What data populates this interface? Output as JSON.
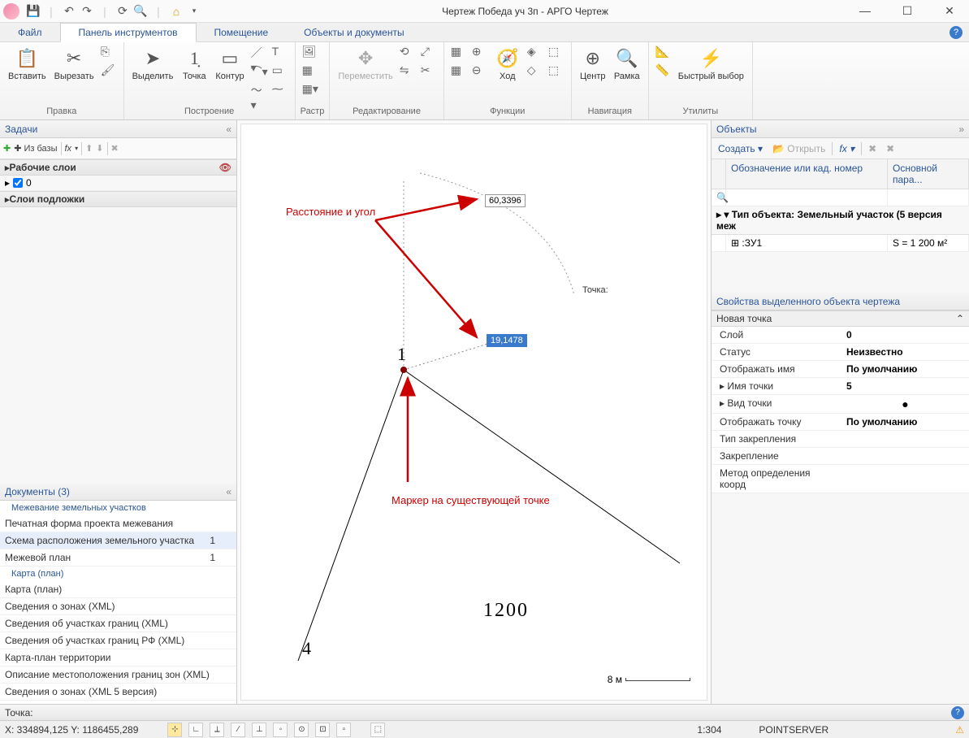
{
  "title": "Чертеж Победа уч 3п - АРГО Чертеж",
  "menutabs": [
    "Файл",
    "Панель инструментов",
    "Помещение",
    "Объекты и документы"
  ],
  "ribbon_groups": {
    "pravka": {
      "label": "Правка",
      "paste": "Вставить",
      "cut": "Вырезать"
    },
    "postroenie": {
      "label": "Построение",
      "select": "Выделить",
      "point": "Точка",
      "contour": "Контур"
    },
    "rastr": {
      "label": "Растр"
    },
    "redaktirovanie": {
      "label": "Редактирование",
      "move": "Переместить"
    },
    "funktsii": {
      "label": "Функции",
      "xod": "Ход"
    },
    "navigatsiya": {
      "label": "Навигация",
      "center": "Центр",
      "frame": "Рамка"
    },
    "utility": {
      "label": "Утилиты",
      "quick": "Быстрый выбор"
    }
  },
  "left_panel": {
    "tasks_title": "Задачи",
    "from_base": "Из базы",
    "fx": "fx",
    "layers_title": "Рабочие слои",
    "layer0": "0",
    "substrate_title": "Слои подложки",
    "documents_title": "Документы (3)",
    "groups": {
      "survey": "Межевание земельных участков",
      "map": "Карта (план)"
    },
    "docs": [
      {
        "name": "Печатная форма проекта межевания",
        "count": ""
      },
      {
        "name": "Схема расположения земельного участка",
        "count": "1"
      },
      {
        "name": "Межевой план",
        "count": "1"
      }
    ],
    "mapdocs": [
      "Карта (план)",
      "Сведения о зонах (XML)",
      "Сведения об участках границ (XML)",
      "Сведения об участках границ РФ (XML)",
      "Карта-план территории",
      "Описание местоположения границ зон (XML)",
      "Сведения о зонах (XML 5 версия)"
    ]
  },
  "right_panel": {
    "objects_title": "Объекты",
    "create": "Создать",
    "open": "Открыть",
    "col1": "Обозначение или кад. номер",
    "col2": "Основной пара...",
    "group": "Тип объекта: Земельный участок (5 версия меж",
    "row_name": ":ЗУ1",
    "row_val": "S = 1 200 м²",
    "props_title": "Свойства выделенного объекта чертежа",
    "new_point": "Новая точка",
    "props": [
      {
        "k": "Слой",
        "v": "0",
        "bold": true
      },
      {
        "k": "Статус",
        "v": "Неизвестно",
        "bold": true
      },
      {
        "k": "Отображать имя",
        "v": "По умолчанию",
        "bold": true
      },
      {
        "k": "Имя точки",
        "v": "5",
        "bold": true
      },
      {
        "k": "Вид точки",
        "v": "●",
        "bold": false
      },
      {
        "k": "Отображать точку",
        "v": "По умолчанию",
        "bold": true
      },
      {
        "k": "Тип закрепления",
        "v": "",
        "bold": false
      },
      {
        "k": "Закрепление",
        "v": "",
        "bold": false
      },
      {
        "k": "Метод определения коорд",
        "v": "",
        "bold": false
      }
    ]
  },
  "canvas": {
    "point_label": "1",
    "point4": "4",
    "area": "1200",
    "dist_box": "60,3396",
    "angle_box": "19,1478",
    "tochka": "Точка:",
    "scale_text": "8 м",
    "anno1": "Расстояние и угол",
    "anno2": "Маркер на существующей точке"
  },
  "status": {
    "tochka": "Точка:",
    "coords": "X: 334894,125 Y: 1186455,289",
    "scale": "1:304",
    "server": "POINTSERVER"
  }
}
